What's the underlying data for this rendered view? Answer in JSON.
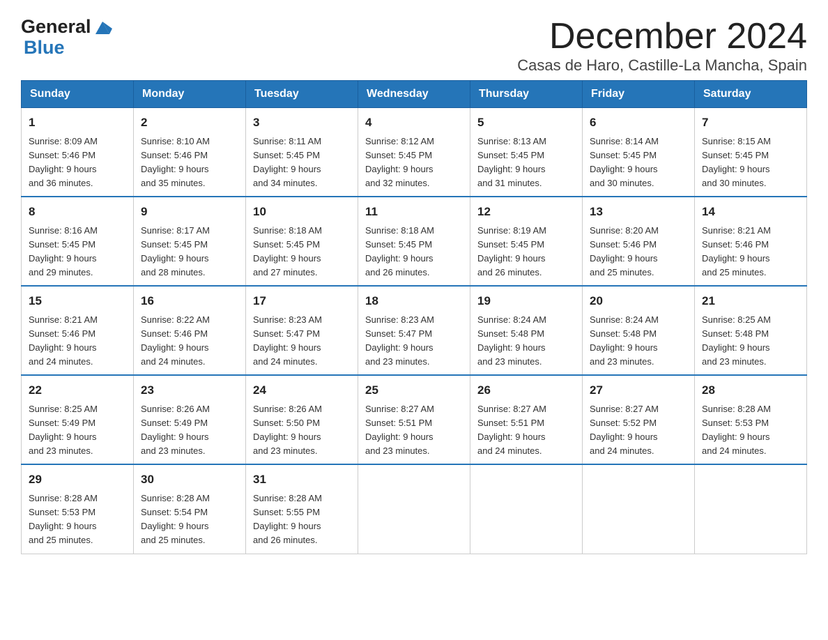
{
  "header": {
    "month_title": "December 2024",
    "location": "Casas de Haro, Castille-La Mancha, Spain"
  },
  "logo": {
    "general": "General",
    "blue": "Blue"
  },
  "days_of_week": [
    "Sunday",
    "Monday",
    "Tuesday",
    "Wednesday",
    "Thursday",
    "Friday",
    "Saturday"
  ],
  "weeks": [
    [
      {
        "day": "1",
        "sunrise": "8:09 AM",
        "sunset": "5:46 PM",
        "daylight": "9 hours and 36 minutes."
      },
      {
        "day": "2",
        "sunrise": "8:10 AM",
        "sunset": "5:46 PM",
        "daylight": "9 hours and 35 minutes."
      },
      {
        "day": "3",
        "sunrise": "8:11 AM",
        "sunset": "5:45 PM",
        "daylight": "9 hours and 34 minutes."
      },
      {
        "day": "4",
        "sunrise": "8:12 AM",
        "sunset": "5:45 PM",
        "daylight": "9 hours and 32 minutes."
      },
      {
        "day": "5",
        "sunrise": "8:13 AM",
        "sunset": "5:45 PM",
        "daylight": "9 hours and 31 minutes."
      },
      {
        "day": "6",
        "sunrise": "8:14 AM",
        "sunset": "5:45 PM",
        "daylight": "9 hours and 30 minutes."
      },
      {
        "day": "7",
        "sunrise": "8:15 AM",
        "sunset": "5:45 PM",
        "daylight": "9 hours and 30 minutes."
      }
    ],
    [
      {
        "day": "8",
        "sunrise": "8:16 AM",
        "sunset": "5:45 PM",
        "daylight": "9 hours and 29 minutes."
      },
      {
        "day": "9",
        "sunrise": "8:17 AM",
        "sunset": "5:45 PM",
        "daylight": "9 hours and 28 minutes."
      },
      {
        "day": "10",
        "sunrise": "8:18 AM",
        "sunset": "5:45 PM",
        "daylight": "9 hours and 27 minutes."
      },
      {
        "day": "11",
        "sunrise": "8:18 AM",
        "sunset": "5:45 PM",
        "daylight": "9 hours and 26 minutes."
      },
      {
        "day": "12",
        "sunrise": "8:19 AM",
        "sunset": "5:45 PM",
        "daylight": "9 hours and 26 minutes."
      },
      {
        "day": "13",
        "sunrise": "8:20 AM",
        "sunset": "5:46 PM",
        "daylight": "9 hours and 25 minutes."
      },
      {
        "day": "14",
        "sunrise": "8:21 AM",
        "sunset": "5:46 PM",
        "daylight": "9 hours and 25 minutes."
      }
    ],
    [
      {
        "day": "15",
        "sunrise": "8:21 AM",
        "sunset": "5:46 PM",
        "daylight": "9 hours and 24 minutes."
      },
      {
        "day": "16",
        "sunrise": "8:22 AM",
        "sunset": "5:46 PM",
        "daylight": "9 hours and 24 minutes."
      },
      {
        "day": "17",
        "sunrise": "8:23 AM",
        "sunset": "5:47 PM",
        "daylight": "9 hours and 24 minutes."
      },
      {
        "day": "18",
        "sunrise": "8:23 AM",
        "sunset": "5:47 PM",
        "daylight": "9 hours and 23 minutes."
      },
      {
        "day": "19",
        "sunrise": "8:24 AM",
        "sunset": "5:48 PM",
        "daylight": "9 hours and 23 minutes."
      },
      {
        "day": "20",
        "sunrise": "8:24 AM",
        "sunset": "5:48 PM",
        "daylight": "9 hours and 23 minutes."
      },
      {
        "day": "21",
        "sunrise": "8:25 AM",
        "sunset": "5:48 PM",
        "daylight": "9 hours and 23 minutes."
      }
    ],
    [
      {
        "day": "22",
        "sunrise": "8:25 AM",
        "sunset": "5:49 PM",
        "daylight": "9 hours and 23 minutes."
      },
      {
        "day": "23",
        "sunrise": "8:26 AM",
        "sunset": "5:49 PM",
        "daylight": "9 hours and 23 minutes."
      },
      {
        "day": "24",
        "sunrise": "8:26 AM",
        "sunset": "5:50 PM",
        "daylight": "9 hours and 23 minutes."
      },
      {
        "day": "25",
        "sunrise": "8:27 AM",
        "sunset": "5:51 PM",
        "daylight": "9 hours and 23 minutes."
      },
      {
        "day": "26",
        "sunrise": "8:27 AM",
        "sunset": "5:51 PM",
        "daylight": "9 hours and 24 minutes."
      },
      {
        "day": "27",
        "sunrise": "8:27 AM",
        "sunset": "5:52 PM",
        "daylight": "9 hours and 24 minutes."
      },
      {
        "day": "28",
        "sunrise": "8:28 AM",
        "sunset": "5:53 PM",
        "daylight": "9 hours and 24 minutes."
      }
    ],
    [
      {
        "day": "29",
        "sunrise": "8:28 AM",
        "sunset": "5:53 PM",
        "daylight": "9 hours and 25 minutes."
      },
      {
        "day": "30",
        "sunrise": "8:28 AM",
        "sunset": "5:54 PM",
        "daylight": "9 hours and 25 minutes."
      },
      {
        "day": "31",
        "sunrise": "8:28 AM",
        "sunset": "5:55 PM",
        "daylight": "9 hours and 26 minutes."
      },
      null,
      null,
      null,
      null
    ]
  ]
}
